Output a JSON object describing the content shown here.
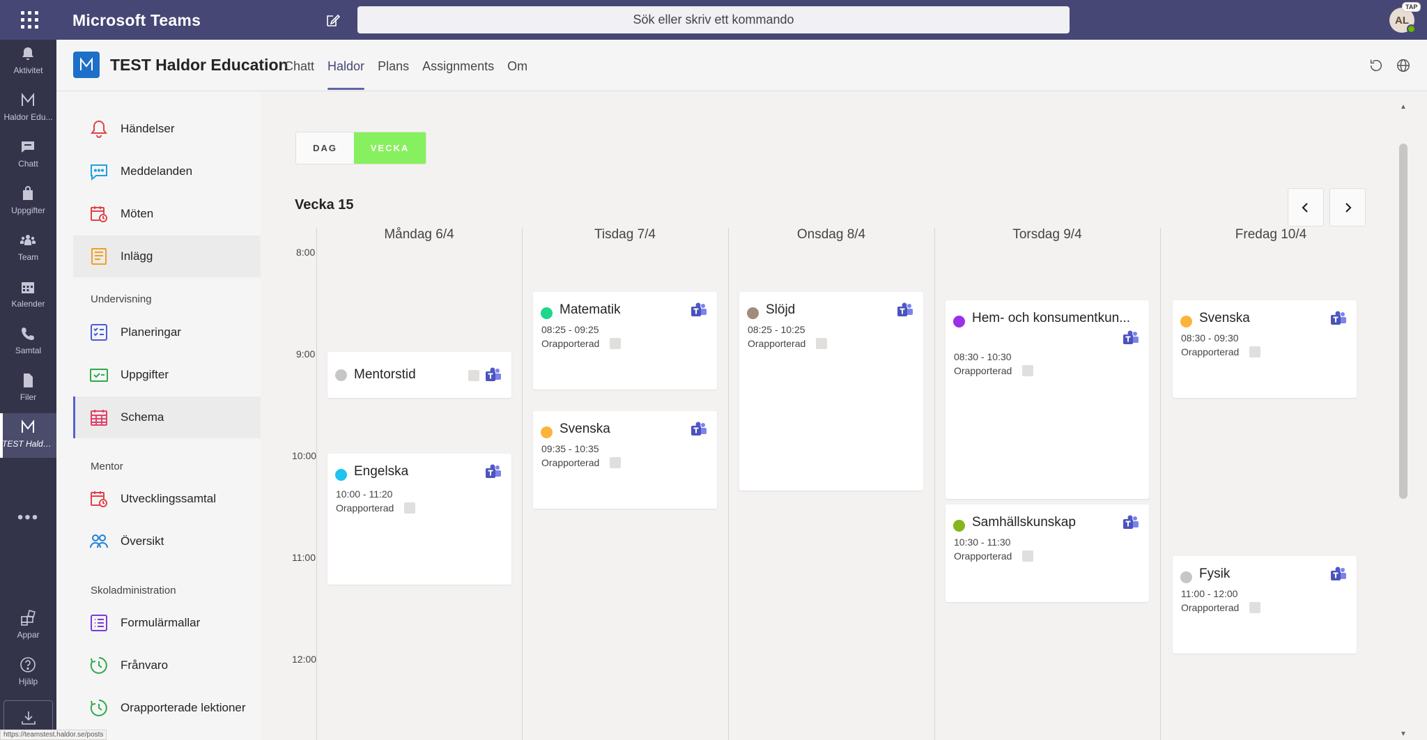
{
  "topbar": {
    "app_title": "Microsoft Teams",
    "search_placeholder": "Sök eller skriv ett kommando",
    "avatar_initials": "AL",
    "avatar_badge": "TAP"
  },
  "rail": {
    "items": [
      {
        "label": "Aktivitet",
        "icon": "bell-icon"
      },
      {
        "label": "Haldor Edu...",
        "icon": "haldor-icon"
      },
      {
        "label": "Chatt",
        "icon": "chat-icon"
      },
      {
        "label": "Uppgifter",
        "icon": "bag-icon"
      },
      {
        "label": "Team",
        "icon": "team-icon"
      },
      {
        "label": "Kalender",
        "icon": "calendar-icon"
      },
      {
        "label": "Samtal",
        "icon": "phone-icon"
      },
      {
        "label": "Filer",
        "icon": "file-icon"
      },
      {
        "label": "TEST Haldor...",
        "icon": "haldor-icon"
      },
      {
        "label": "Appar",
        "icon": "apps-icon"
      },
      {
        "label": "Hjälp",
        "icon": "help-icon"
      }
    ],
    "more": "•••"
  },
  "apphead": {
    "name": "TEST Haldor Education",
    "tabs": [
      "Chatt",
      "Haldor",
      "Plans",
      "Assignments",
      "Om"
    ],
    "active_tab": "Haldor"
  },
  "nav": {
    "items": [
      {
        "label": "Händelser"
      },
      {
        "label": "Meddelanden"
      },
      {
        "label": "Möten"
      },
      {
        "label": "Inlägg"
      },
      {
        "label": "Planeringar"
      },
      {
        "label": "Uppgifter"
      },
      {
        "label": "Schema"
      },
      {
        "label": "Utvecklingssamtal"
      },
      {
        "label": "Översikt"
      },
      {
        "label": "Formulärmallar"
      },
      {
        "label": "Frånvaro"
      },
      {
        "label": "Orapporterade lektioner"
      }
    ],
    "sections": {
      "teaching": "Undervisning",
      "mentor": "Mentor",
      "admin": "Skoladministration"
    }
  },
  "schedule": {
    "view_day": "DAG",
    "view_week": "VECKA",
    "week_title": "Vecka 15",
    "times": [
      "8:00",
      "9:00",
      "10:00",
      "11:00",
      "12:00"
    ],
    "days": [
      "Måndag 6/4",
      "Tisdag 7/4",
      "Onsdag 8/4",
      "Torsdag 9/4",
      "Fredag 10/4"
    ],
    "status_label": "Orapporterad",
    "lessons": {
      "mentorstid": {
        "title": "Mentorstid",
        "color": "#c8c6c4"
      },
      "engelska": {
        "title": "Engelska",
        "time": "10:00 - 11:20",
        "color": "#1ec3f0"
      },
      "matematik": {
        "title": "Matematik",
        "time": "08:25 - 09:25",
        "color": "#1ed68c"
      },
      "svenska_tis": {
        "title": "Svenska",
        "time": "09:35 - 10:35",
        "color": "#fbb43a"
      },
      "slojd": {
        "title": "Slöjd",
        "time": "08:25 - 10:25",
        "color": "#a38b7b"
      },
      "hem": {
        "title": "Hem- och konsumentkun...",
        "time": "08:30 - 10:30",
        "color": "#9b30e8"
      },
      "samhall": {
        "title": "Samhällskunskap",
        "time": "10:30 - 11:30",
        "color": "#86b51e"
      },
      "svenska_fre": {
        "title": "Svenska",
        "time": "08:30 - 09:30",
        "color": "#fbb43a"
      },
      "fysik": {
        "title": "Fysik",
        "time": "11:00 - 12:00",
        "color": "#c8c6c4"
      }
    }
  },
  "status_url": "https://teamstest.haldor.se/posts",
  "colors": {
    "teams_purple": "#464775",
    "rail_bg": "#33344a",
    "accent": "#6264a7",
    "week_toggle": "#86f05e"
  }
}
